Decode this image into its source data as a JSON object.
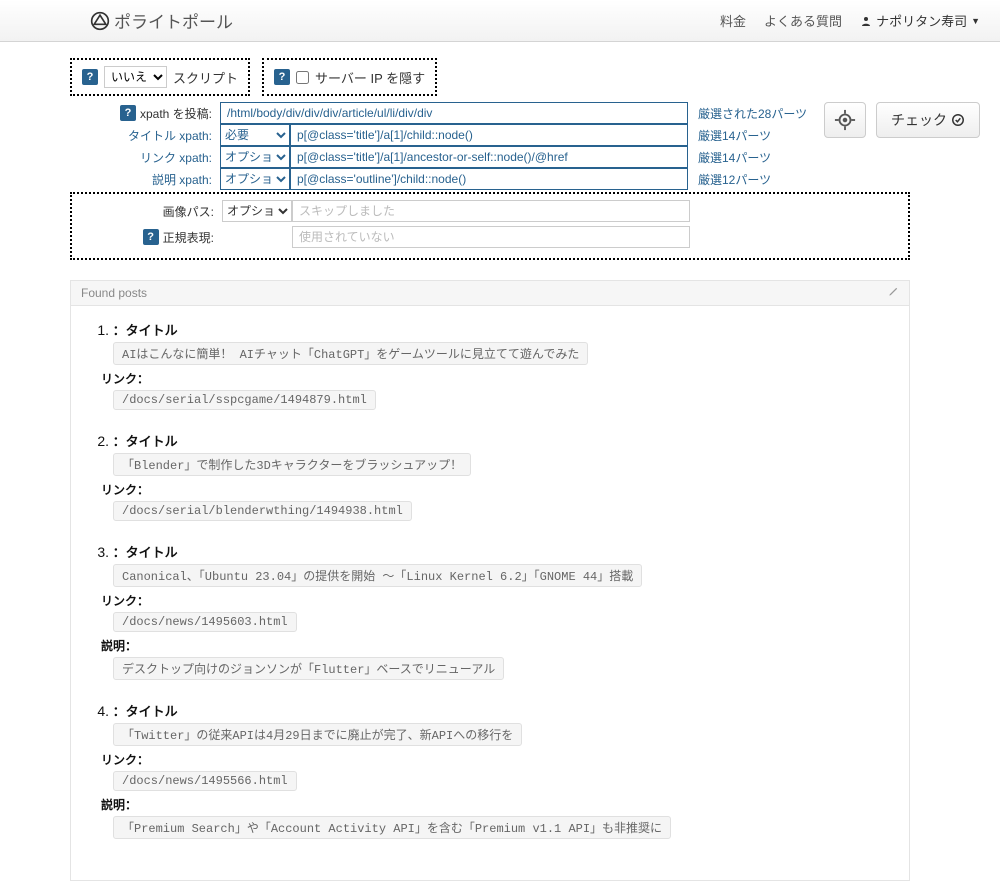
{
  "nav": {
    "brand": "ポライトポール",
    "pricing": "料金",
    "faq": "よくある質問",
    "user": "ナポリタン寿司"
  },
  "top": {
    "scriptSelect": "いいえ",
    "scriptLabel": "スクリプト",
    "hideIpLabel": "サーバー IP を隠す"
  },
  "form": {
    "postXpathLabel": "xpath を投稿:",
    "postXpathValue": "/html/body/div/div/div/article/ul/li/div/div",
    "postXpathHint": "厳選された28パーツ",
    "titleLabel": "タイトル xpath:",
    "titleSelect": "必要",
    "titleValue": "p[@class='title']/a[1]/child::node()",
    "titleHint": "厳選14パーツ",
    "linkLabel": "リンク xpath:",
    "linkSelect": "オプション",
    "linkValue": "p[@class='title']/a[1]/ancestor-or-self::node()/@href",
    "linkHint": "厳選14パーツ",
    "descLabel": "説明 xpath:",
    "descSelect": "オプション",
    "descValue": "p[@class='outline']/child::node()",
    "descHint": "厳選12パーツ",
    "imgLabel": "画像パス:",
    "imgSelect": "オプション",
    "imgPlaceholder": "スキップしました",
    "regexLabel": "正規表現:",
    "regexPlaceholder": "使用されていない"
  },
  "buttons": {
    "check": "チェック"
  },
  "results": {
    "header": "Found posts",
    "titleLabel": "：タイトル",
    "linkLabel": "リンク：",
    "descLabel": "説明：",
    "items": [
      {
        "num": "1.",
        "title": "AIはこんなに簡単！ AIチャット「ChatGPT」をゲームツールに見立てて遊んでみた",
        "link": "/docs/serial/sspcgame/1494879.html"
      },
      {
        "num": "2.",
        "title": "「Blender」で制作した3Dキャラクターをブラッシュアップ！",
        "link": "/docs/serial/blenderwthing/1494938.html"
      },
      {
        "num": "3.",
        "title": "Canonical、「Ubuntu 23.04」の提供を開始 ～「Linux Kernel 6.2」「GNOME 44」搭載",
        "link": "/docs/news/1495603.html",
        "desc": "デスクトップ向けのジョンソンが「Flutter」ベースでリニューアル"
      },
      {
        "num": "4.",
        "title": "「Twitter」の従来APIは4月29日までに廃止が完了、新APIへの移行を",
        "link": "/docs/news/1495566.html",
        "desc": "「Premium Search」や「Account Activity API」を含む「Premium v1.1 API」も非推奨に"
      }
    ]
  }
}
